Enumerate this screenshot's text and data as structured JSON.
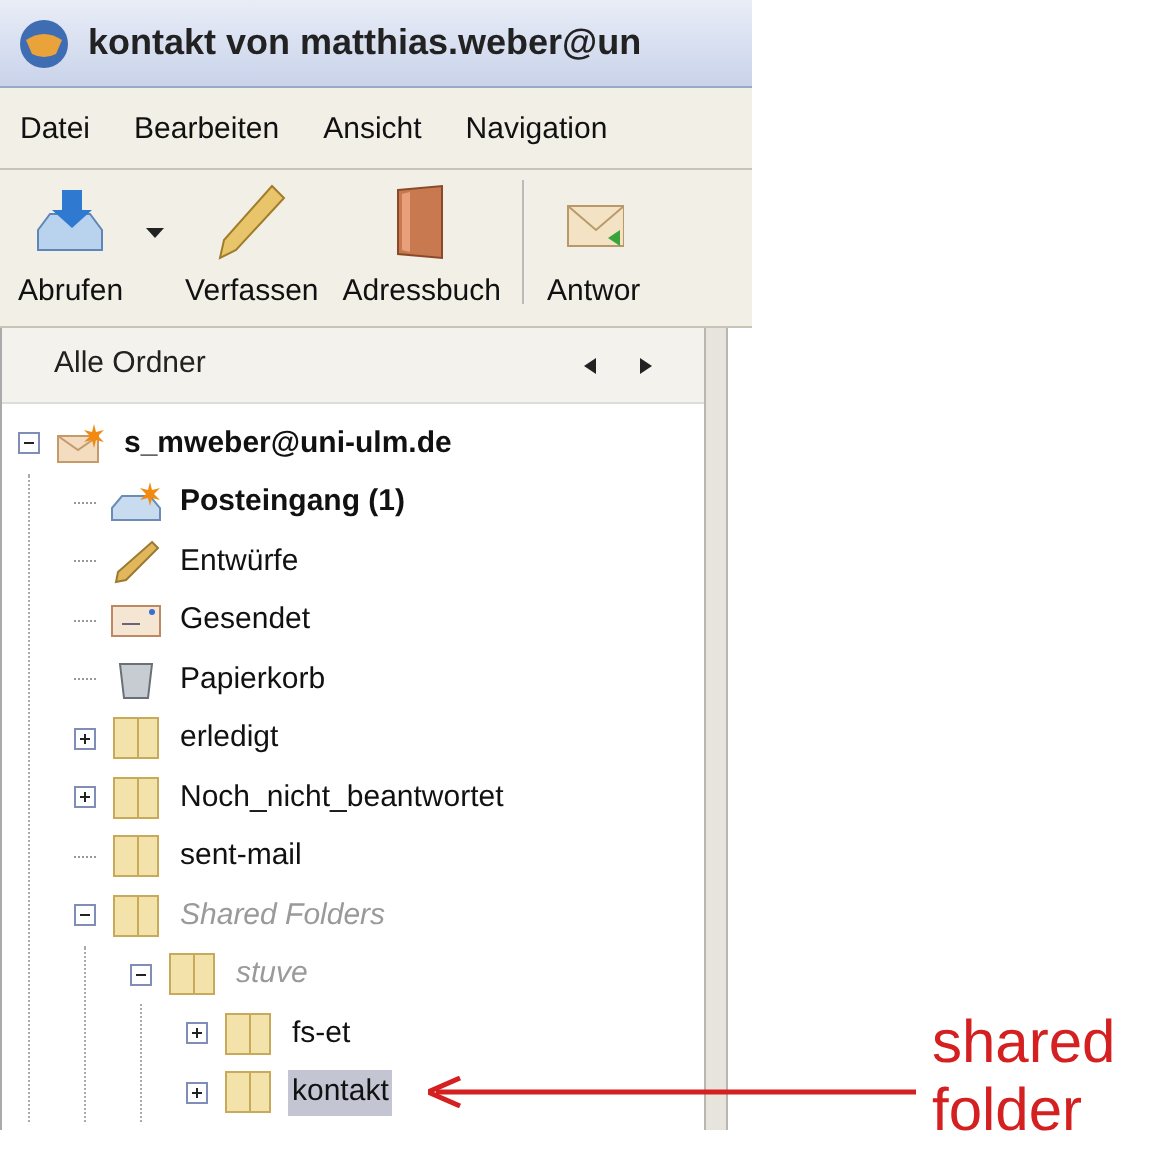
{
  "window": {
    "title": "kontakt von matthias.weber@un"
  },
  "menu": [
    "Datei",
    "Bearbeiten",
    "Ansicht",
    "Navigation"
  ],
  "toolbar": [
    {
      "kind": "get",
      "label": "Abrufen"
    },
    {
      "kind": "dropdown"
    },
    {
      "kind": "write",
      "label": "Verfassen"
    },
    {
      "kind": "addressbook",
      "label": "Adressbuch"
    },
    {
      "kind": "separator"
    },
    {
      "kind": "reply",
      "label": "Antwor"
    }
  ],
  "folder_pane": {
    "header": "Alle Ordner",
    "tree": [
      {
        "label": "s_mweber@uni-ulm.de",
        "kind": "account",
        "expandable": true,
        "expanded": true,
        "bold": true,
        "dimmed": false,
        "selected": false,
        "children": [
          {
            "label": "Posteingang (1)",
            "kind": "inbox",
            "expandable": false,
            "bold": true,
            "dimmed": false,
            "selected": false
          },
          {
            "label": "Entwürfe",
            "kind": "drafts",
            "expandable": false,
            "bold": false,
            "dimmed": false,
            "selected": false
          },
          {
            "label": "Gesendet",
            "kind": "sent",
            "expandable": false,
            "bold": false,
            "dimmed": false,
            "selected": false
          },
          {
            "label": "Papierkorb",
            "kind": "trash",
            "expandable": false,
            "bold": false,
            "dimmed": false,
            "selected": false
          },
          {
            "label": "erledigt",
            "kind": "folder",
            "expandable": true,
            "expanded": false,
            "bold": false,
            "dimmed": false,
            "selected": false
          },
          {
            "label": "Noch_nicht_beantwortet",
            "kind": "folder",
            "expandable": true,
            "expanded": false,
            "bold": false,
            "dimmed": false,
            "selected": false
          },
          {
            "label": "sent-mail",
            "kind": "folder",
            "expandable": false,
            "bold": false,
            "dimmed": false,
            "selected": false
          },
          {
            "label": "Shared Folders",
            "kind": "folder",
            "expandable": true,
            "expanded": true,
            "bold": false,
            "dimmed": true,
            "selected": false,
            "children": [
              {
                "label": "stuve",
                "kind": "folder",
                "expandable": true,
                "expanded": true,
                "bold": false,
                "dimmed": true,
                "selected": false,
                "children": [
                  {
                    "label": "fs-et",
                    "kind": "folder",
                    "expandable": true,
                    "expanded": false,
                    "bold": false,
                    "dimmed": false,
                    "selected": false
                  },
                  {
                    "label": "kontakt",
                    "kind": "folder",
                    "expandable": true,
                    "expanded": false,
                    "bold": false,
                    "dimmed": false,
                    "selected": true
                  }
                ]
              }
            ]
          }
        ]
      }
    ]
  },
  "annotation": {
    "label": "shared folder"
  }
}
